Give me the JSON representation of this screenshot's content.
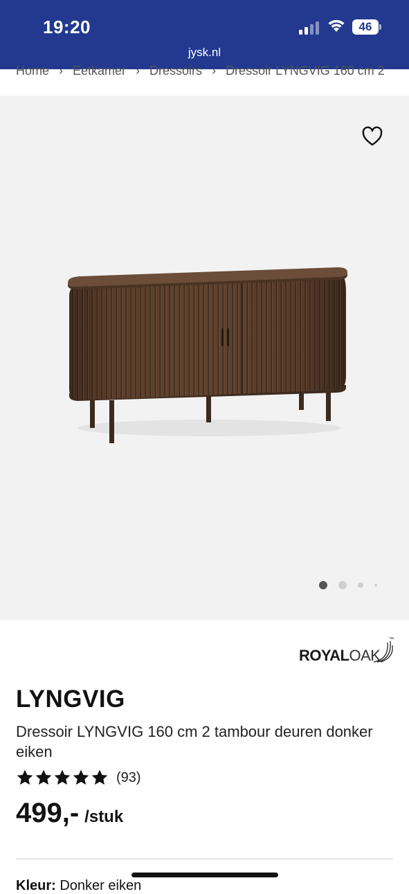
{
  "status_bar": {
    "time": "19:20",
    "battery": "46",
    "url": "jysk.nl",
    "background": "#22398f"
  },
  "breadcrumb": {
    "items": [
      "Home",
      "Eetkamer",
      "Dressoirs",
      "Dressoir LYNGVIG 160 cm 2"
    ],
    "separator": "›"
  },
  "gallery": {
    "favorite_icon": "heart-outline-icon",
    "image_count": 4,
    "active_index": 0
  },
  "brand": {
    "name_bold": "ROYAL",
    "name_light": "OAK",
    "trademark": "™"
  },
  "product": {
    "name": "LYNGVIG",
    "description": "Dressoir LYNGVIG 160 cm 2 tambour deuren donker eiken",
    "rating_stars": 5,
    "review_count": "(93)",
    "price": "499,-",
    "price_unit": "/stuk"
  },
  "next_section": {
    "label": "Kleur:",
    "value": "Donker eiken"
  }
}
